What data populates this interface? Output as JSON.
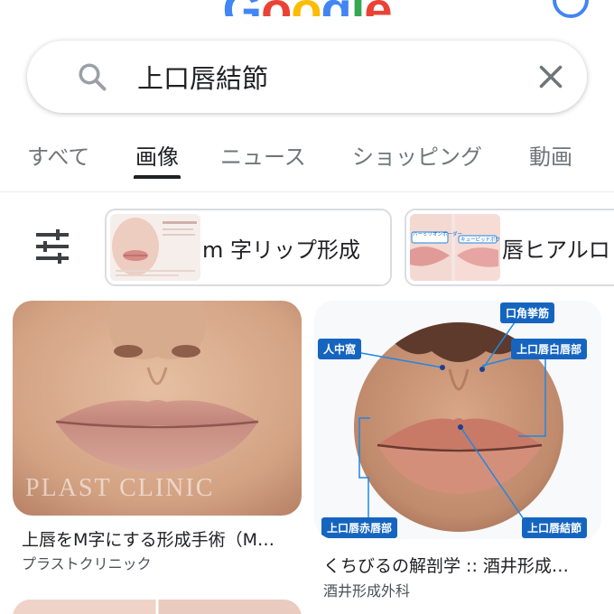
{
  "header": {
    "logo_letters": [
      {
        "char": "G",
        "color": "#4285f4"
      },
      {
        "char": "o",
        "color": "#ea4335"
      },
      {
        "char": "o",
        "color": "#fbbc05"
      },
      {
        "char": "g",
        "color": "#4285f4"
      },
      {
        "char": "l",
        "color": "#34a853"
      },
      {
        "char": "e",
        "color": "#ea4335"
      }
    ]
  },
  "search": {
    "query": "上口唇結節",
    "search_icon": "search-icon",
    "clear_icon": "close-icon"
  },
  "tabs": [
    {
      "label": "すべて",
      "active": false
    },
    {
      "label": "画像",
      "active": true
    },
    {
      "label": "ニュース",
      "active": false
    },
    {
      "label": "ショッピング",
      "active": false
    },
    {
      "label": "動画",
      "active": false
    }
  ],
  "filter": {
    "icon": "tune-icon",
    "chips": [
      {
        "label": "m 字リップ形成"
      },
      {
        "label": "唇ヒアルロ"
      }
    ],
    "chip2_thumb_labels": [
      "バーミリオンボーダー",
      "キューピッドボウ"
    ]
  },
  "results": [
    {
      "title": "上唇をM字にする形成手術（M…",
      "source": "プラストクリニック",
      "watermark": "PLAST CLINIC"
    },
    {
      "title": "くちびるの解剖学 :: 酒井形成…",
      "source": "酒井形成外科",
      "diagram_labels": {
        "philtrum": "人中窩",
        "mouth_corner_lift": "口角挙筋",
        "upper_lip_white": "上口唇白唇部",
        "upper_lip_red": "上口唇赤唇部",
        "upper_lip_tubercle": "上口唇結節"
      }
    }
  ],
  "colors": {
    "accent_blue": "#1565c0",
    "text_primary": "#202124",
    "text_secondary": "#70757a"
  }
}
